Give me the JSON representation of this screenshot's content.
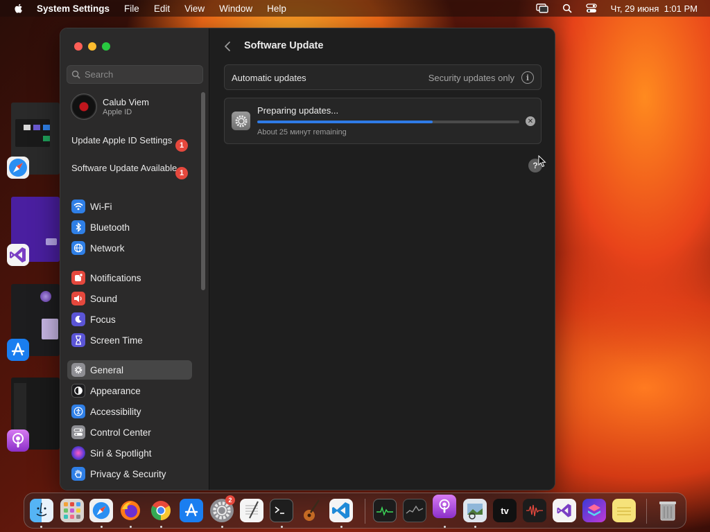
{
  "menubar": {
    "app_name": "System Settings",
    "menus": [
      "File",
      "Edit",
      "View",
      "Window",
      "Help"
    ],
    "datetime": "Чт, 29 июня  1:01 PM"
  },
  "search": {
    "placeholder": "Search"
  },
  "profile": {
    "name": "Calub Viem",
    "subtitle": "Apple ID"
  },
  "alerts": [
    {
      "label": "Update Apple ID Settings",
      "badge": "1"
    },
    {
      "label": "Software Update Available",
      "badge": "1"
    }
  ],
  "sidebar": {
    "items": [
      {
        "label": "Wi-Fi",
        "icon": "wifi-icon",
        "color": "#2f7fe6"
      },
      {
        "label": "Bluetooth",
        "icon": "bluetooth-icon",
        "color": "#2f7fe6"
      },
      {
        "label": "Network",
        "icon": "globe-icon",
        "color": "#2f7fe6"
      },
      {
        "label": "Notifications",
        "icon": "bell-icon",
        "color": "#e5483d"
      },
      {
        "label": "Sound",
        "icon": "speaker-icon",
        "color": "#e5483d"
      },
      {
        "label": "Focus",
        "icon": "moon-icon",
        "color": "#5b55d6"
      },
      {
        "label": "Screen Time",
        "icon": "hourglass-icon",
        "color": "#5b55d6"
      },
      {
        "label": "General",
        "icon": "gear-icon",
        "color": "#8e8e93"
      },
      {
        "label": "Appearance",
        "icon": "appearance-icon",
        "color": "#1c1c1e"
      },
      {
        "label": "Accessibility",
        "icon": "accessibility-icon",
        "color": "#2f7fe6"
      },
      {
        "label": "Control Center",
        "icon": "control-center-icon",
        "color": "#8e8e93"
      },
      {
        "label": "Siri & Spotlight",
        "icon": "siri-icon",
        "color": "#8a3fd1"
      },
      {
        "label": "Privacy & Security",
        "icon": "hand-icon",
        "color": "#2f7fe6"
      }
    ],
    "selected": "General"
  },
  "content": {
    "title": "Software Update",
    "automatic_updates": {
      "label": "Automatic updates",
      "value": "Security updates only"
    },
    "update": {
      "status": "Preparing updates...",
      "progress": 0.67,
      "remaining": "About 25 минут remaining"
    }
  },
  "dock": {
    "apps": [
      {
        "name": "Finder",
        "icon": "finder-icon"
      },
      {
        "name": "Launchpad",
        "icon": "launchpad-icon"
      },
      {
        "name": "Safari",
        "icon": "safari-icon"
      },
      {
        "name": "Firefox",
        "icon": "firefox-icon"
      },
      {
        "name": "Chrome",
        "icon": "chrome-icon"
      },
      {
        "name": "App Store",
        "icon": "app-store-icon"
      },
      {
        "name": "System Settings",
        "icon": "system-settings-icon",
        "badge": "2"
      },
      {
        "name": "TextEdit",
        "icon": "textedit-icon"
      },
      {
        "name": "Terminal",
        "icon": "terminal-icon"
      },
      {
        "name": "GarageBand",
        "icon": "guitar-icon"
      },
      {
        "name": "Visual Studio Code",
        "icon": "vscode-icon"
      },
      {
        "name": "Activity Monitor",
        "icon": "activity-monitor-icon"
      },
      {
        "name": "Stocks",
        "icon": "stocks-icon"
      },
      {
        "name": "Podcasts",
        "icon": "podcasts-icon"
      },
      {
        "name": "Preview",
        "icon": "preview-icon"
      },
      {
        "name": "TV",
        "icon": "apple-tv-icon",
        "label": "tv"
      },
      {
        "name": "Voice Memos",
        "icon": "voice-memos-icon"
      },
      {
        "name": "Visual Studio",
        "icon": "visual-studio-icon"
      },
      {
        "name": "Shortcuts",
        "icon": "shortcuts-icon"
      },
      {
        "name": "Notes",
        "icon": "notes-icon"
      },
      {
        "name": "Trash",
        "icon": "trash-icon"
      }
    ]
  }
}
